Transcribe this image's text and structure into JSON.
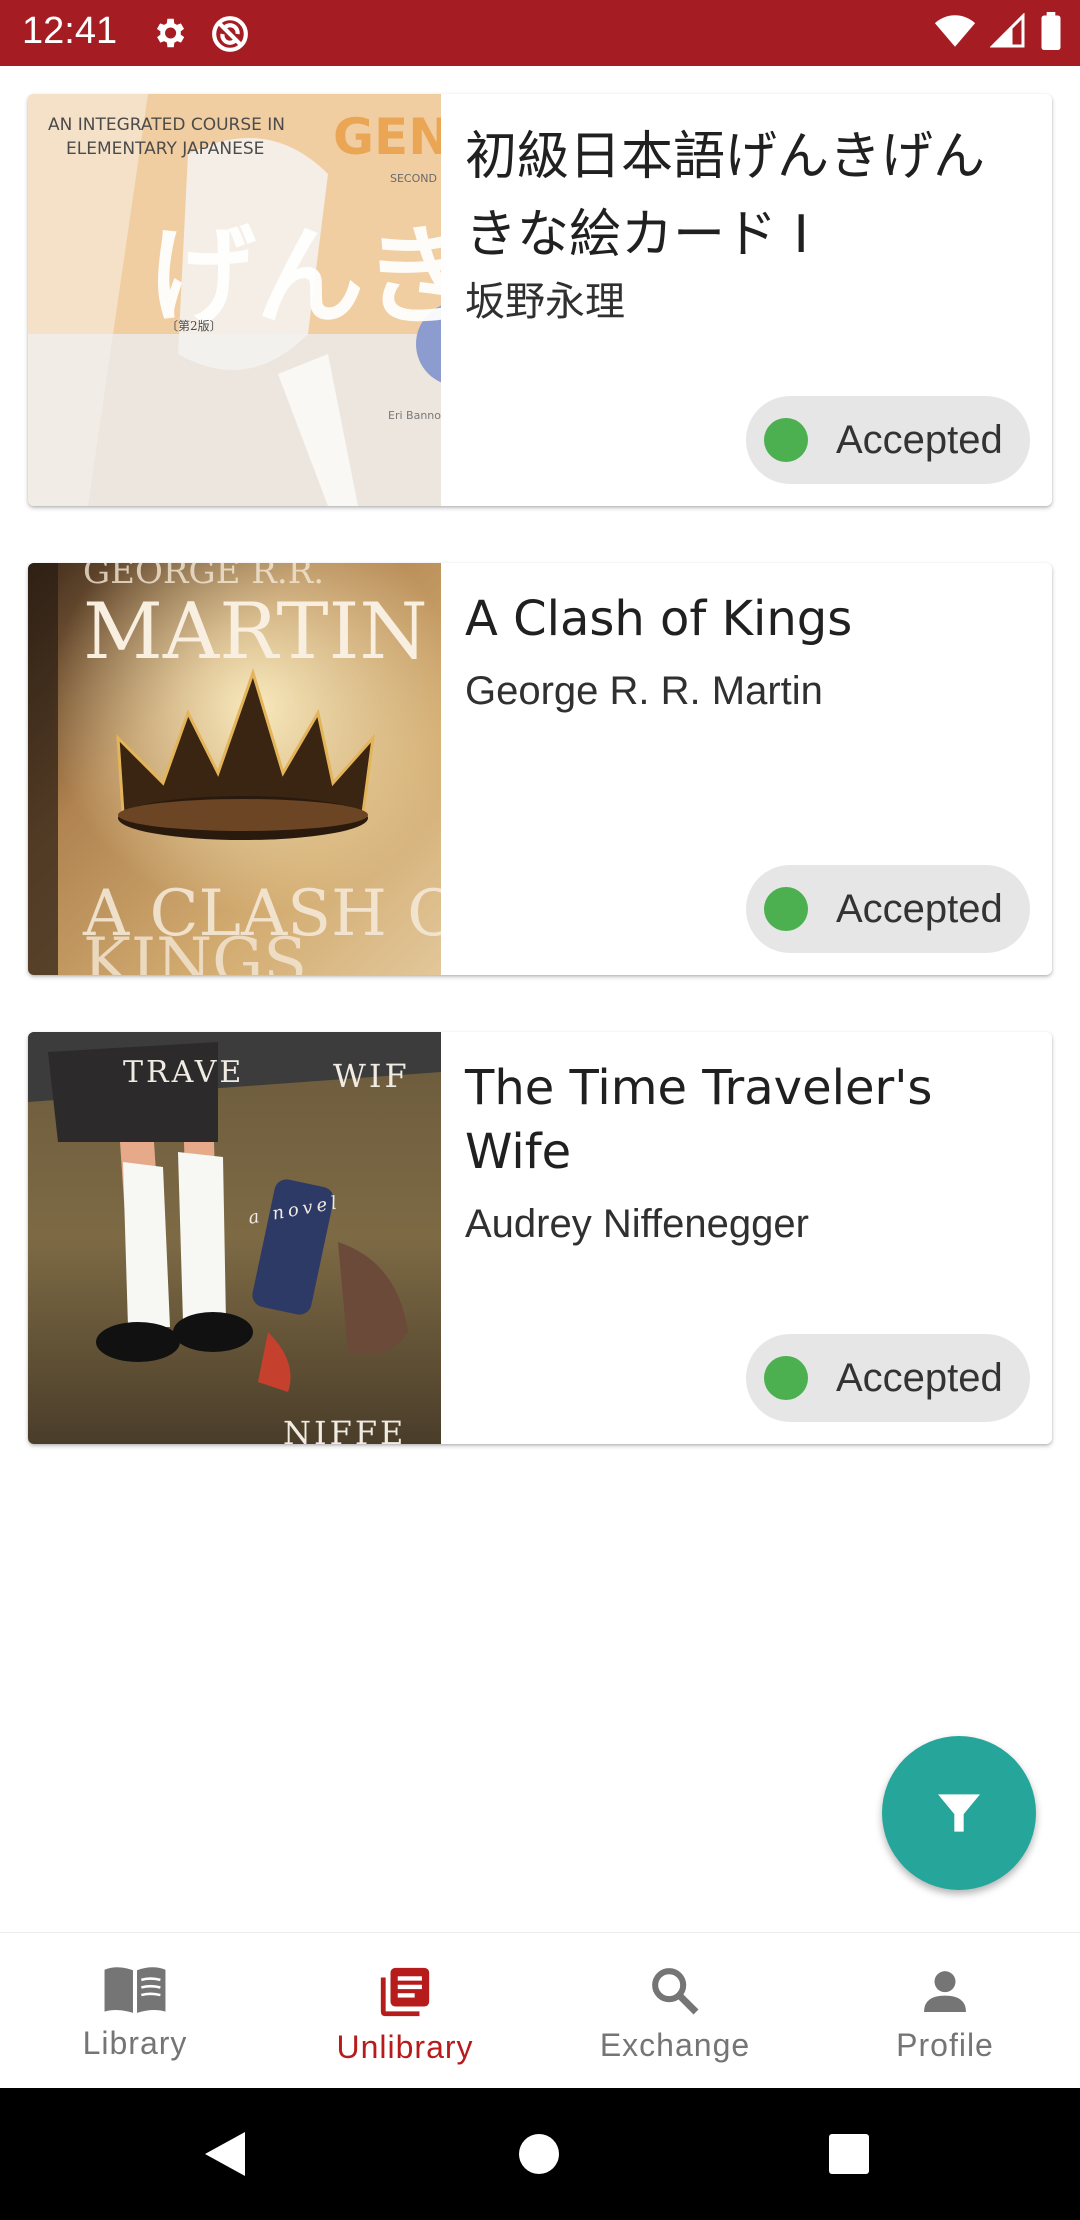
{
  "status_bar": {
    "time": "12:41",
    "color": "#a51c22",
    "left_icons": [
      "gear-icon",
      "no-sync-icon"
    ],
    "right_icons": [
      "wifi-icon",
      "cell-signal-icon",
      "battery-icon"
    ]
  },
  "books": [
    {
      "title": "初級日本語げんきげんきな絵カード I",
      "author": "坂野永理",
      "status": "Accepted"
    },
    {
      "title": "A Clash of Kings",
      "author": "George R. R. Martin",
      "status": "Accepted"
    },
    {
      "title": "The Time Traveler's Wife",
      "author": "Audrey Niffenegger",
      "status": "Accepted"
    }
  ],
  "covers": {
    "genki": {
      "line1": "AN INTEGRATED COURSE IN",
      "line2": "ELEMENTARY JAPANESE",
      "big": "げんき",
      "brand": "GEN",
      "second": "SECOND",
      "edition": "〔第2版〕",
      "authors": "Eri Banno"
    },
    "clash": {
      "top": "MARTIN",
      "bottom": "A CLASH OF"
    },
    "wife": {
      "top": "TRAVE",
      "top2": "WIF",
      "sub": "a novel",
      "bottom": "NIFFE"
    }
  },
  "status_colors": {
    "accepted": "#4caf50"
  },
  "fab": {
    "icon": "filter-icon",
    "color": "#26a69a"
  },
  "bottom_nav": {
    "items": [
      {
        "label": "Library",
        "icon": "book-open-icon",
        "active": false
      },
      {
        "label": "Unlibrary",
        "icon": "library-books-icon",
        "active": true
      },
      {
        "label": "Exchange",
        "icon": "search-icon",
        "active": false
      },
      {
        "label": "Profile",
        "icon": "person-icon",
        "active": false
      }
    ],
    "active_color": "#b71c1c"
  }
}
